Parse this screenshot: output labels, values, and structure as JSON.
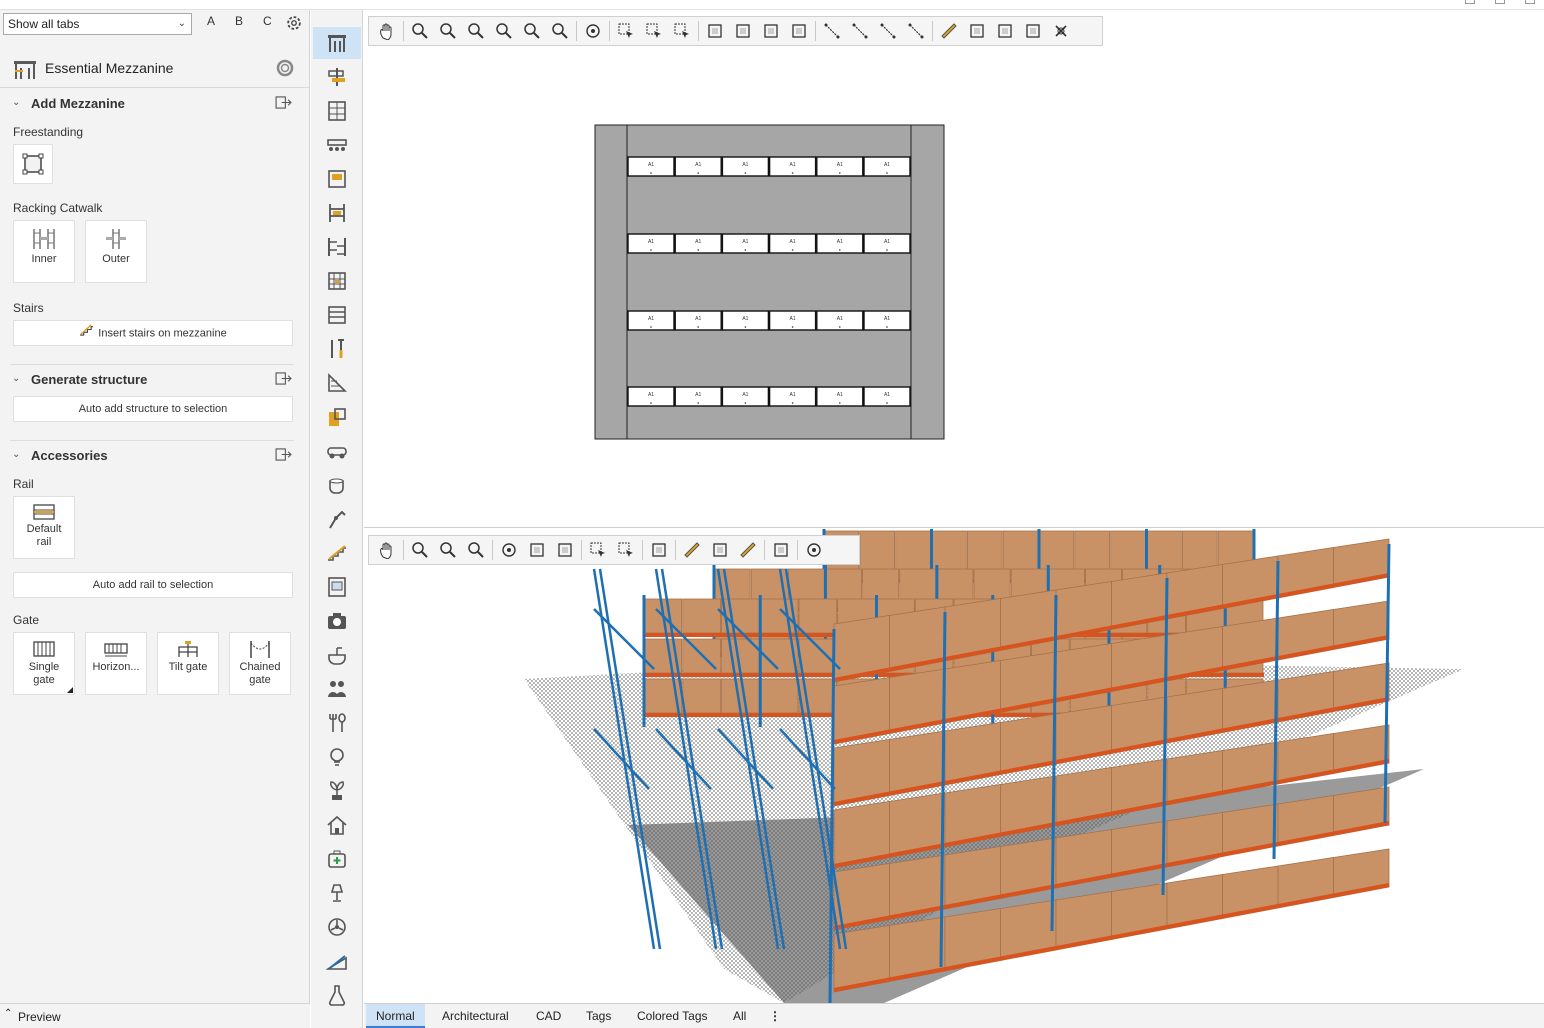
{
  "panel": {
    "tab_filter": "Show all tabs",
    "letters": [
      "A",
      "B",
      "C"
    ],
    "title": "Essential Mezzanine",
    "add_mezzanine": {
      "heading": "Add Mezzanine",
      "freestanding_label": "Freestanding",
      "racking_label": "Racking Catwalk",
      "inner": "Inner",
      "outer": "Outer",
      "stairs_label": "Stairs",
      "stairs_button": "Insert stairs on mezzanine"
    },
    "generate": {
      "heading": "Generate structure",
      "button": "Auto add structure to selection"
    },
    "accessories": {
      "heading": "Accessories",
      "rail_label": "Rail",
      "default_rail_line1": "Default",
      "default_rail_line2": "rail",
      "rail_button": "Auto add rail to selection",
      "gate_label": "Gate",
      "single_gate_line1": "Single",
      "single_gate_line2": "gate",
      "horizontal": "Horizon...",
      "tilt_gate": "Tilt gate",
      "chained_line1": "Chained",
      "chained_line2": "gate"
    },
    "preview": "Preview"
  },
  "rail_icons": [
    "mezzanine-icon",
    "signpost-icon",
    "shelving-icon",
    "conveyor-icon",
    "pallet-icon",
    "racking-icon",
    "cantilever-icon",
    "drive-in-icon",
    "bin-icon",
    "tools-icon",
    "wall-icon",
    "block-icon",
    "vehicle-icon",
    "coffee-icon",
    "robot-arm-icon",
    "stairs-icon",
    "window-icon",
    "camera-icon",
    "sink-icon",
    "people-icon",
    "kitchen-icon",
    "lightbulb-icon",
    "plant-icon",
    "house-icon",
    "first-aid-icon",
    "lamp-icon",
    "fan-icon",
    "ramp-icon",
    "lab-icon"
  ],
  "plan": {
    "rows": 4,
    "bays_per_row": 6,
    "bay_tag": "A1"
  },
  "view_tabs": [
    "Normal",
    "Architectural",
    "CAD",
    "Tags",
    "Colored Tags",
    "All"
  ],
  "active_view_tab": "Normal",
  "colors": {
    "upright": "#1f6fb3",
    "beam": "#d9531e",
    "box": "#c89266",
    "floor": "#9a9a9a",
    "selection": "#cfe3f6"
  }
}
